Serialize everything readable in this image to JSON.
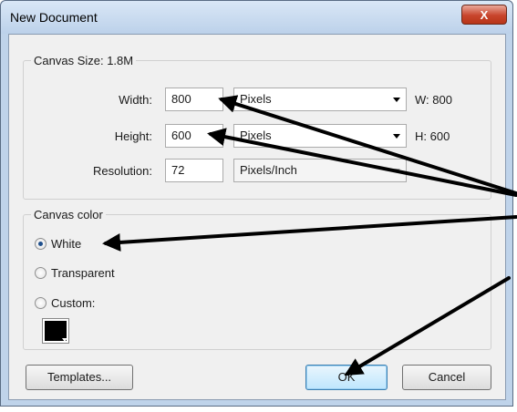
{
  "window": {
    "title": "New Document",
    "close_label": "X"
  },
  "canvas_size": {
    "legend": "Canvas Size: 1.8M",
    "width": {
      "label": "Width:",
      "value": "800",
      "unit": "Pixels",
      "readout": "W: 800"
    },
    "height": {
      "label": "Height:",
      "value": "600",
      "unit": "Pixels",
      "readout": "H: 600"
    },
    "resolution": {
      "label": "Resolution:",
      "value": "72",
      "unit": "Pixels/Inch"
    }
  },
  "canvas_color": {
    "legend": "Canvas color",
    "options": [
      {
        "label": "White",
        "checked": true
      },
      {
        "label": "Transparent",
        "checked": false
      },
      {
        "label": "Custom:",
        "checked": false
      }
    ],
    "custom_swatch_color": "#000000"
  },
  "buttons": {
    "templates": "Templates...",
    "ok": "OK",
    "cancel": "Cancel"
  },
  "colors": {
    "frame": "#bfd3ea",
    "client": "#f0f0f0",
    "close": "#c8452c",
    "annotation_arrow": "#000000"
  }
}
